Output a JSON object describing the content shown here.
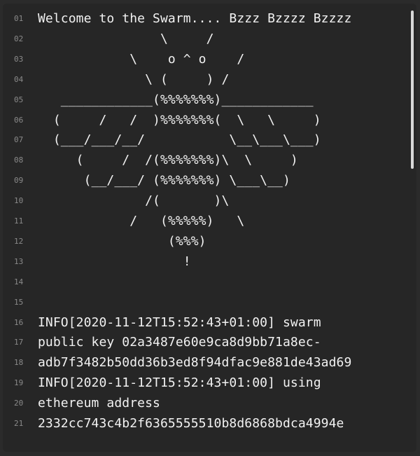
{
  "terminal": {
    "lines": [
      {
        "num": "01",
        "text": "Welcome to the Swarm.... Bzzz Bzzzz Bzzzz"
      },
      {
        "num": "02",
        "text": "                \\     /"
      },
      {
        "num": "03",
        "text": "            \\    o ^ o    /"
      },
      {
        "num": "04",
        "text": "              \\ (     ) /"
      },
      {
        "num": "05",
        "text": "   ____________(%%%%%%%)____________"
      },
      {
        "num": "06",
        "text": "  (     /   /  )%%%%%%%(  \\   \\     )"
      },
      {
        "num": "07",
        "text": "  (___/___/__/           \\__\\___\\___)"
      },
      {
        "num": "08",
        "text": "     (     /  /(%%%%%%%)\\  \\     )"
      },
      {
        "num": "09",
        "text": "      (__/___/ (%%%%%%%) \\___\\__)"
      },
      {
        "num": "10",
        "text": "              /(       )\\"
      },
      {
        "num": "11",
        "text": "            /   (%%%%%)   \\"
      },
      {
        "num": "12",
        "text": "                 (%%%)"
      },
      {
        "num": "13",
        "text": "                   !"
      },
      {
        "num": "14",
        "text": ""
      },
      {
        "num": "15",
        "text": ""
      },
      {
        "num": "16",
        "text": "INFO[2020-11-12T15:52:43+01:00] swarm"
      },
      {
        "num": "17",
        "text": "public key 02a3487e60e9ca8d9bb71a8ec-"
      },
      {
        "num": "18",
        "text": "adb7f3482b50dd36b3ed8f94dfac9e881de43ad69"
      },
      {
        "num": "19",
        "text": "INFO[2020-11-12T15:52:43+01:00] using"
      },
      {
        "num": "20",
        "text": "ethereum address"
      },
      {
        "num": "21",
        "text": "2332cc743c4b2f6365555510b8d6868bdca4994e"
      }
    ]
  }
}
